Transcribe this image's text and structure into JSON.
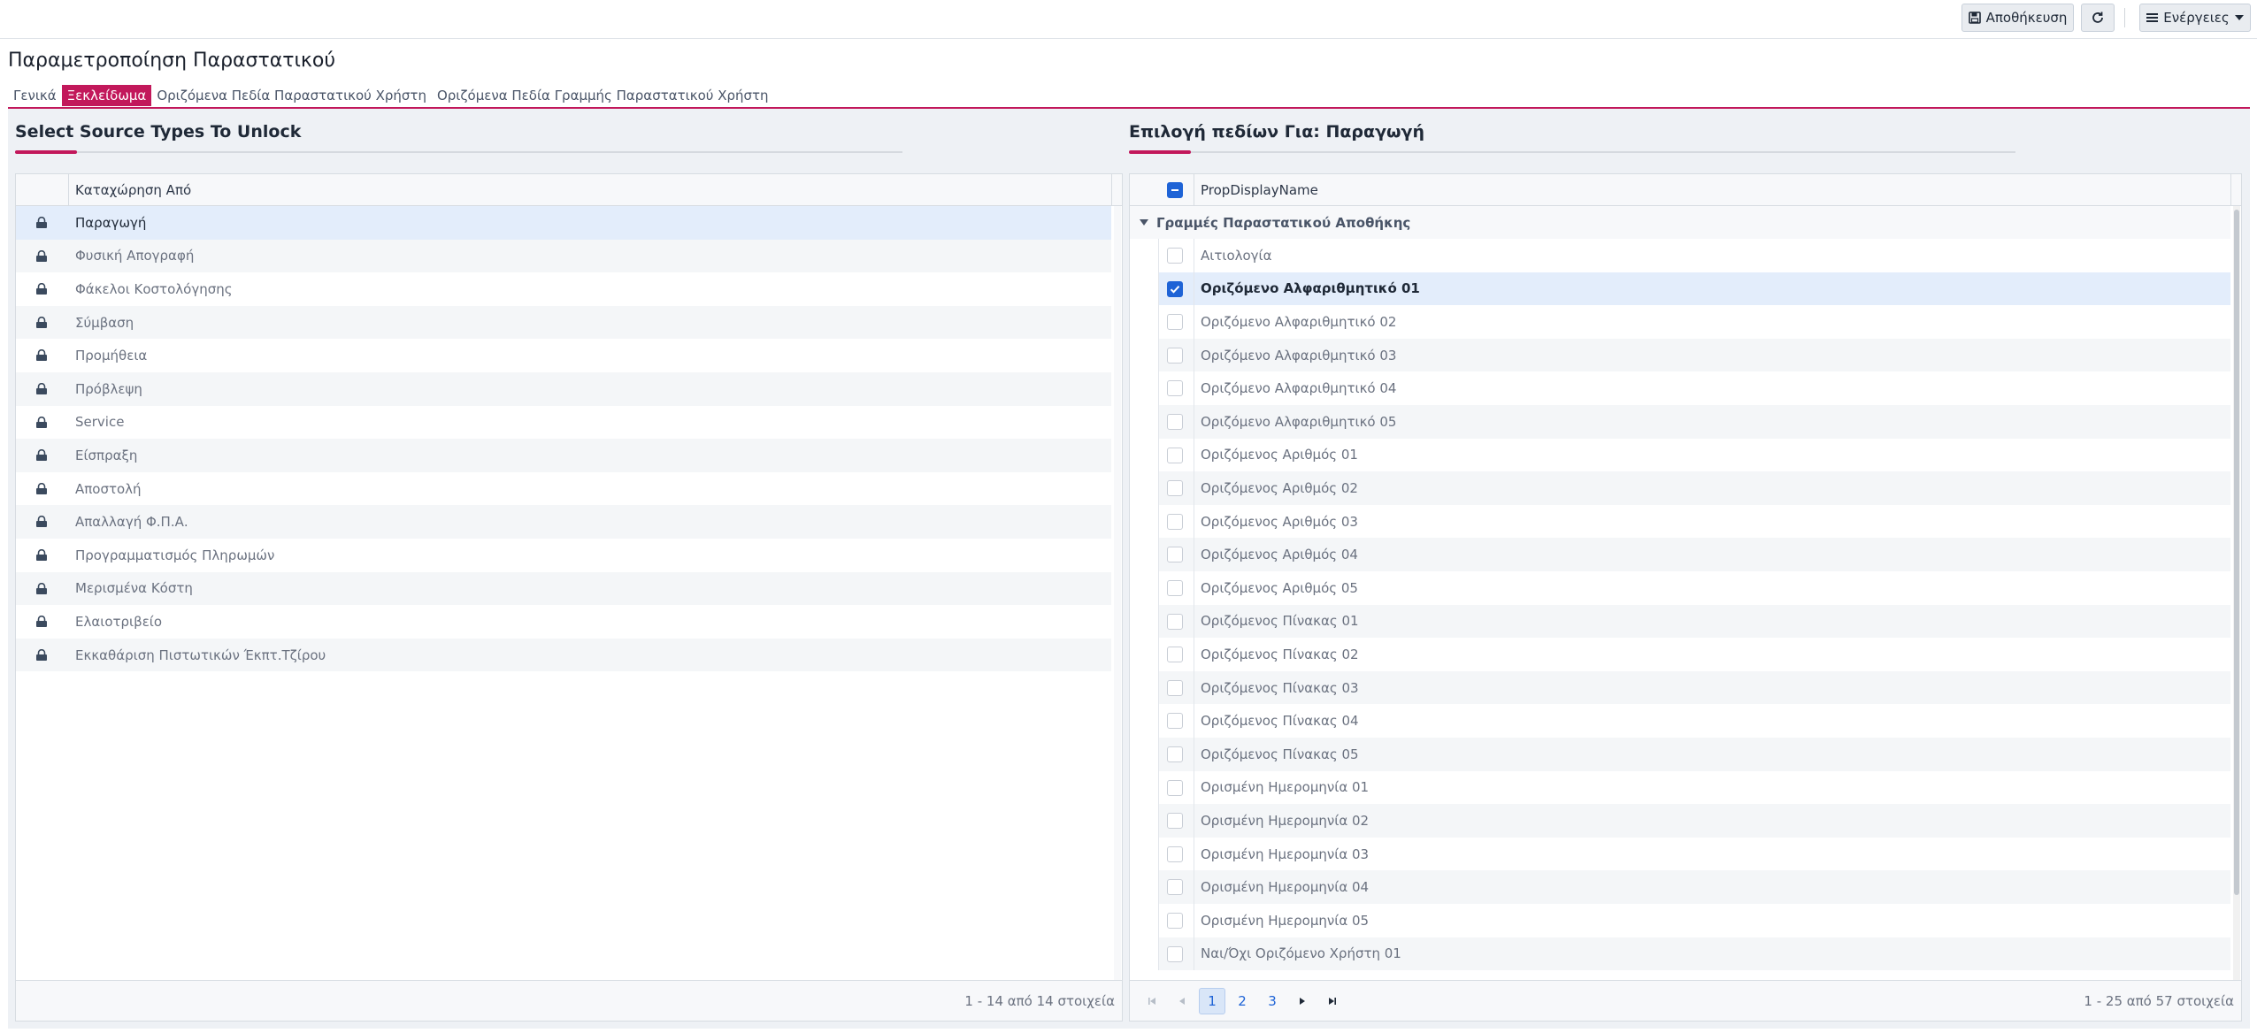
{
  "toolbar": {
    "save_label": "Αποθήκευση",
    "actions_label": "Ενέργειες"
  },
  "page_title": "Παραμετροποίηση Παραστατικού",
  "tabs": [
    {
      "label": "Γενικά"
    },
    {
      "label": "Ξεκλείδωμα"
    },
    {
      "label": "Οριζόμενα Πεδία Παραστατικού Χρήστη"
    },
    {
      "label": "Οριζόμενα Πεδία Γραμμής Παραστατικού Χρήστη"
    }
  ],
  "left": {
    "title": "Select Source Types To Unlock",
    "column_header": "Καταχώρηση Από",
    "rows": [
      "Παραγωγή",
      "Φυσική Απογραφή",
      "Φάκελοι Κοστολόγησης",
      "Σύμβαση",
      "Προμήθεια",
      "Πρόβλεψη",
      "Service",
      "Είσπραξη",
      "Αποστολή",
      "Απαλλαγή Φ.Π.Α.",
      "Προγραμματισμός Πληρωμών",
      "Μερισμένα Κόστη",
      "Ελαιοτριβείο",
      "Εκκαθάριση Πιστωτικών Έκπτ.Τζίρου"
    ],
    "footer_info": "1 - 14 από 14 στοιχεία"
  },
  "right": {
    "title": "Επιλογή πεδίων Για: Παραγωγή",
    "column_header": "PropDisplayName",
    "group_label": "Γραμμές Παραστατικού Αποθήκης",
    "rows": [
      "Αιτιολογία",
      "Οριζόμενο Αλφαριθμητικό 01",
      "Οριζόμενο Αλφαριθμητικό 02",
      "Οριζόμενο Αλφαριθμητικό 03",
      "Οριζόμενο Αλφαριθμητικό 04",
      "Οριζόμενο Αλφαριθμητικό 05",
      "Οριζόμενος Αριθμός 01",
      "Οριζόμενος Αριθμός 02",
      "Οριζόμενος Αριθμός 03",
      "Οριζόμενος Αριθμός 04",
      "Οριζόμενος Αριθμός 05",
      "Οριζόμενος Πίνακας 01",
      "Οριζόμενος Πίνακας 02",
      "Οριζόμενος Πίνακας 03",
      "Οριζόμενος Πίνακας 04",
      "Οριζόμενος Πίνακας 05",
      "Ορισμένη Ημερομηνία 01",
      "Ορισμένη Ημερομηνία 02",
      "Ορισμένη Ημερομηνία 03",
      "Ορισμένη Ημερομηνία 04",
      "Ορισμένη Ημερομηνία 05",
      "Ναι/Όχι Οριζόμενο Χρήστη 01"
    ],
    "checked_index": 1,
    "pages": [
      "1",
      "2",
      "3"
    ],
    "current_page": "1",
    "footer_info": "1 - 25 από 57 στοιχεία"
  },
  "colors": {
    "accent": "#c2185b",
    "primary": "#1e63d6"
  },
  "icons": {
    "save": "save-icon",
    "refresh": "refresh-icon",
    "actions": "menu-icon",
    "lock": "lock-icon"
  }
}
